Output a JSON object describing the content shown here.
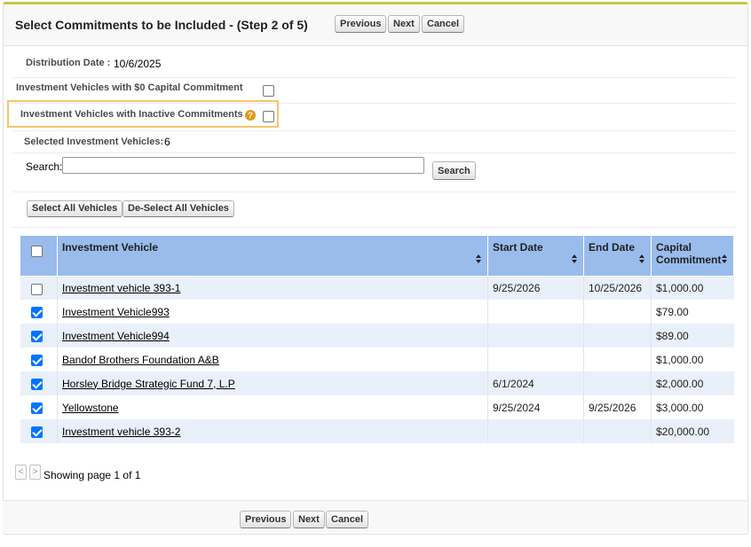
{
  "header": {
    "title": "Select Commitments to be Included - (Step 2 of 5)",
    "previous_label": "Previous",
    "next_label": "Next",
    "cancel_label": "Cancel"
  },
  "form": {
    "distribution_date_label": "Distribution Date :",
    "distribution_date_value": "10/6/2025",
    "zero_commitment_label": "Investment Vehicles with $0 Capital Commitment",
    "zero_commitment_checked": false,
    "inactive_label": "Investment Vehicles with Inactive Commitments",
    "inactive_checked": false,
    "help_icon": "help-icon",
    "selected_label": "Selected Investment Vehicles:",
    "selected_count": "6",
    "search_label": "Search:",
    "search_value": "",
    "search_button": "Search",
    "select_all_button": "Select All Vehicles",
    "deselect_all_button": "De-Select All Vehicles"
  },
  "table": {
    "columns": [
      "Investment Vehicle",
      "Start Date",
      "End Date",
      "Capital Commitment"
    ],
    "rows": [
      {
        "checked": false,
        "vehicle": "Investment vehicle 393-1",
        "start": "9/25/2026",
        "end": "10/25/2026",
        "commitment": "$1,000.00"
      },
      {
        "checked": true,
        "vehicle": "Investment Vehicle993",
        "start": "",
        "end": "",
        "commitment": "$79.00"
      },
      {
        "checked": true,
        "vehicle": "Investment Vehicle994",
        "start": "",
        "end": "",
        "commitment": "$89.00"
      },
      {
        "checked": true,
        "vehicle": "Bandof Brothers Foundation A&B",
        "start": "",
        "end": "",
        "commitment": "$1,000.00"
      },
      {
        "checked": true,
        "vehicle": "Horsley Bridge Strategic Fund 7, L.P",
        "start": "6/1/2024",
        "end": "",
        "commitment": "$2,000.00"
      },
      {
        "checked": true,
        "vehicle": "Yellowstone",
        "start": "9/25/2024",
        "end": "9/25/2026",
        "commitment": "$3,000.00"
      },
      {
        "checked": true,
        "vehicle": "Investment vehicle 393-2",
        "start": "",
        "end": "",
        "commitment": "$20,000.00"
      }
    ]
  },
  "pagination": {
    "prev_glyph": "<",
    "next_glyph": ">",
    "status": "Showing page 1 of 1"
  },
  "footer": {
    "previous_label": "Previous",
    "next_label": "Next",
    "cancel_label": "Cancel"
  },
  "colors": {
    "header_row": "#99bcec",
    "accent_highlight": "#f5c66b",
    "checkbox_on": "#0075ff",
    "top_border": "#c6c64a"
  }
}
